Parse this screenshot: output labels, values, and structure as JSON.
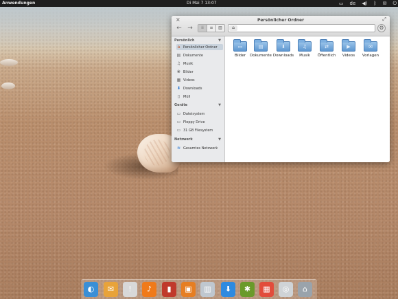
{
  "top_panel": {
    "apps_menu": "Anwendungen",
    "clock": "Di Mai  7 13:07",
    "indicators": [
      {
        "name": "display-icon",
        "glyph": "▭"
      },
      {
        "name": "keyboard-layout",
        "label": "de"
      },
      {
        "name": "volume-icon",
        "glyph": "◀)"
      },
      {
        "name": "bluetooth-icon",
        "glyph": "ᛒ"
      },
      {
        "name": "mail-icon",
        "glyph": "✉"
      },
      {
        "name": "power-icon",
        "glyph": "⏻"
      }
    ]
  },
  "window": {
    "title": "Persönlicher Ordner",
    "close_glyph": "×",
    "maximize_glyph": "⤢",
    "back_glyph": "←",
    "forward_glyph": "→",
    "views": [
      {
        "name": "icon-view",
        "glyph": "⁞⁞"
      },
      {
        "name": "list-view",
        "glyph": "≡"
      },
      {
        "name": "column-view",
        "glyph": "▥"
      }
    ],
    "home_glyph": "⌂",
    "gear_glyph": "⚙",
    "sidebar": {
      "sections": [
        {
          "title": "Persönlich",
          "items": [
            {
              "label": "Persönlicher Ordner",
              "icon": "home-icon",
              "glyph": "⌂",
              "selected": true
            },
            {
              "label": "Dokumente",
              "icon": "document-icon",
              "glyph": "▤"
            },
            {
              "label": "Musik",
              "icon": "music-icon",
              "glyph": "♫"
            },
            {
              "label": "Bilder",
              "icon": "pictures-icon",
              "glyph": "❀"
            },
            {
              "label": "Videos",
              "icon": "video-icon",
              "glyph": "▦"
            },
            {
              "label": "Downloads",
              "icon": "download-icon",
              "glyph": "⬇"
            },
            {
              "label": "Müll",
              "icon": "trash-icon",
              "glyph": "▯"
            }
          ]
        },
        {
          "title": "Geräte",
          "items": [
            {
              "label": "Dateisystem",
              "icon": "drive-icon",
              "glyph": "▭"
            },
            {
              "label": "Floppy Drive",
              "icon": "floppy-icon",
              "glyph": "▭"
            },
            {
              "label": "31 GB Filesystem",
              "icon": "drive-icon",
              "glyph": "▭"
            }
          ]
        },
        {
          "title": "Netzwerk",
          "items": [
            {
              "label": "Gesamtes Netzwerk",
              "icon": "network-icon",
              "glyph": "≋"
            }
          ]
        }
      ],
      "collapse_glyph": "▼"
    },
    "folders": [
      {
        "label": "Bilder",
        "glyph": "▭"
      },
      {
        "label": "Dokumente",
        "glyph": "▤"
      },
      {
        "label": "Downloads",
        "glyph": "⬇"
      },
      {
        "label": "Musik",
        "glyph": "♫"
      },
      {
        "label": "Öffentlich",
        "glyph": "⇄"
      },
      {
        "label": "Videos",
        "glyph": "▶"
      },
      {
        "label": "Vorlagen",
        "glyph": "✉"
      }
    ]
  },
  "dock": {
    "items": [
      {
        "name": "browser-icon",
        "glyph": "◐",
        "color": "#3a8fd6"
      },
      {
        "name": "mail-app-icon",
        "glyph": "✉",
        "color": "#e8a33a"
      },
      {
        "name": "notification-icon",
        "glyph": "!",
        "color": "#d8d8d8"
      },
      {
        "name": "music-app-icon",
        "glyph": "♪",
        "color": "#f07a1a"
      },
      {
        "name": "video-app-icon",
        "glyph": "▮",
        "color": "#c0392b"
      },
      {
        "name": "photos-app-icon",
        "glyph": "▣",
        "color": "#e67e22"
      },
      {
        "name": "switcher-app-icon",
        "glyph": "▥",
        "color": "#bfc7cf"
      },
      {
        "name": "download-app-icon",
        "glyph": "⬇",
        "color": "#2d8ae0"
      },
      {
        "name": "bug-app-icon",
        "glyph": "✱",
        "color": "#6a9a2a"
      },
      {
        "name": "calendar-app-icon",
        "glyph": "▦",
        "color": "#e24c3b"
      },
      {
        "name": "disc-app-icon",
        "glyph": "◎",
        "color": "#cfd3d6"
      },
      {
        "name": "files-app-icon",
        "glyph": "⌂",
        "color": "#9aa3ab"
      }
    ]
  }
}
